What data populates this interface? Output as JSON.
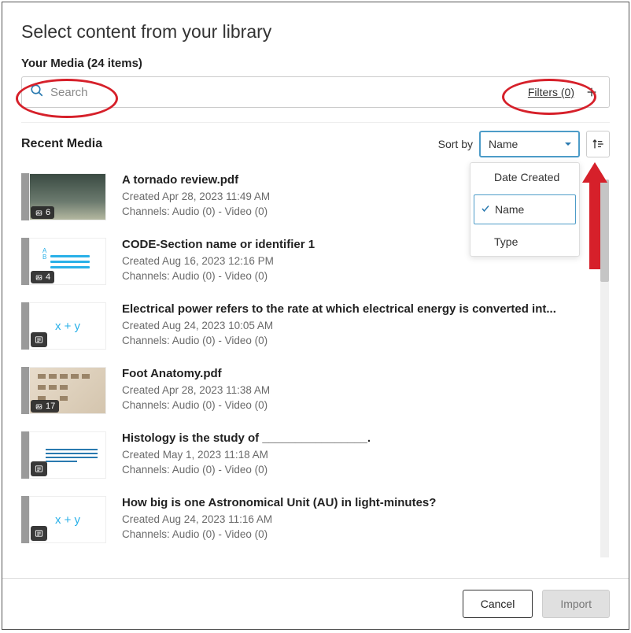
{
  "title": "Select content from your library",
  "yourMediaLabel": "Your Media (24 items)",
  "search": {
    "placeholder": "Search"
  },
  "filters": {
    "label": "Filters (0)"
  },
  "recentLabel": "Recent Media",
  "sort": {
    "label": "Sort by",
    "selected": "Name",
    "options": [
      "Date Created",
      "Name",
      "Type"
    ]
  },
  "items": [
    {
      "title": "A tornado review.pdf",
      "created": "Created Apr 28, 2023 11:49 AM",
      "channels": "Channels: Audio (0) - Video (0)",
      "badge": "6",
      "thumbType": "tornado"
    },
    {
      "title": "CODE-Section name or identifier 1",
      "created": "Created Aug 16, 2023 12:16 PM",
      "channels": "Channels: Audio (0) - Video (0)",
      "badge": "4",
      "thumbType": "code"
    },
    {
      "title": "Electrical power refers to the rate at which electrical energy is converted int...",
      "created": "Created Aug 24, 2023 10:05 AM",
      "channels": "Channels: Audio (0) - Video (0)",
      "thumbType": "xy"
    },
    {
      "title": "Foot Anatomy.pdf",
      "created": "Created Apr 28, 2023 11:38 AM",
      "channels": "Channels: Audio (0) - Video (0)",
      "badge": "17",
      "thumbType": "foot"
    },
    {
      "title": "Histology is the study of ________________.",
      "created": "Created May 1, 2023 11:18 AM",
      "channels": "Channels: Audio (0) - Video (0)",
      "thumbType": "para"
    },
    {
      "title": "How big is one Astronomical Unit (AU) in light-minutes?",
      "created": "Created Aug 24, 2023 11:16 AM",
      "channels": "Channels: Audio (0) - Video (0)",
      "thumbType": "xy"
    }
  ],
  "footer": {
    "cancel": "Cancel",
    "import": "Import"
  }
}
